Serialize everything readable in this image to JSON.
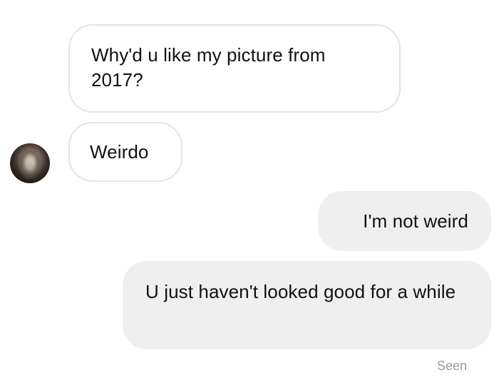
{
  "conversation": {
    "messages": [
      {
        "direction": "incoming",
        "text": "Why'd u like my picture from 2017?"
      },
      {
        "direction": "incoming",
        "text": "Weirdo"
      },
      {
        "direction": "outgoing",
        "text": "I'm not weird"
      },
      {
        "direction": "outgoing",
        "text": "U just haven't looked good for a while"
      }
    ],
    "status": "Seen"
  },
  "colors": {
    "background": "#ffffff",
    "incoming_bubble": "#ffffff",
    "incoming_border": "#e3e3e3",
    "outgoing_bubble": "#efefef",
    "status_text": "#9a9a9a"
  },
  "icons": {
    "sender_avatar": "avatar"
  }
}
